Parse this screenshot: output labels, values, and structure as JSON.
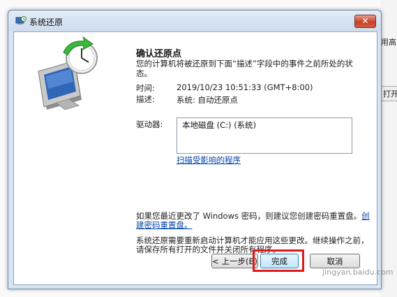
{
  "background": {
    "text_top": "用高",
    "button_text": "打开"
  },
  "window": {
    "title": "系统还原",
    "close_symbol": "✕"
  },
  "content": {
    "heading": "确认还原点",
    "description": "您的计算机将被还原到下面“描述”字段中的事件之前所处的状态。",
    "time_label": "时间:",
    "time_value": "2019/10/23 10:51:33 (GMT+8:00)",
    "desc_label": "描述:",
    "desc_value": "系统: 自动还原点",
    "drives_label": "驱动器:",
    "drives": [
      "本地磁盘 (C:) (系统)"
    ],
    "scan_link": "扫描受影响的程序",
    "password_text": "如果您最近更改了 Windows 密码，则建议您创建密码重置盘。",
    "password_link": "创建密码重置盘。",
    "restart_text": "系统还原需要重新启动计算机才能应用这些更改。继续操作之前，请保存所有打开的文件并关闭所有程序。"
  },
  "buttons": {
    "back": "< 上一步(B)",
    "finish": "完成",
    "cancel": "取消"
  },
  "watermark": "jingyan.baidu.com",
  "colors": {
    "link": "#0645ad",
    "highlight": "#e01818",
    "close_button": "#c7412c"
  }
}
